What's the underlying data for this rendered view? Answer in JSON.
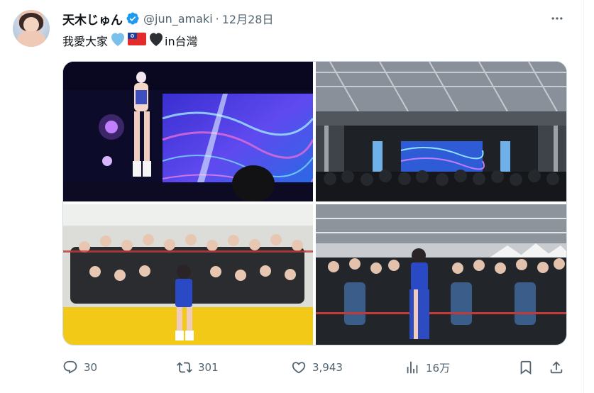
{
  "tweet": {
    "display_name": "天木じゅん",
    "handle": "@jun_amaki",
    "separator": "·",
    "date": "12月28日",
    "text_main": "我愛大家",
    "text_location": " in台灣"
  },
  "icons": {
    "verified": "verified-badge-icon",
    "more": "more-options-icon",
    "reply": "reply-icon",
    "retweet": "retweet-icon",
    "like": "heart-icon",
    "views": "views-icon",
    "bookmark": "bookmark-icon",
    "share": "share-icon"
  },
  "actions": {
    "replies": "30",
    "retweets": "301",
    "likes": "3,943",
    "views": "16万"
  },
  "colors": {
    "text": "#0f1419",
    "secondary": "#536471",
    "verified": "#1d9bf0",
    "border": "#cfd9de"
  }
}
